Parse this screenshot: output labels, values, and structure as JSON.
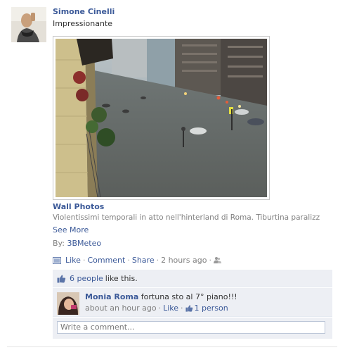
{
  "post": {
    "author": "Simone Cinelli",
    "status": "Impressionante",
    "attachment": {
      "title": "Wall Photos",
      "description": "Violentissimi temporali in atto nell'hinterland di Roma. Tiburtina paralizzata d...",
      "see_more": "See More",
      "by_prefix": "By:",
      "by_name": "3BMeteo"
    },
    "actions": {
      "like": "Like",
      "comment": "Comment",
      "share": "Share",
      "time": "2 hours ago",
      "separator": "·"
    }
  },
  "ufi": {
    "likes_link": "6 people",
    "likes_text": "like this.",
    "comment": {
      "author": "Monia Roma",
      "text": "fortuna sto al 7° piano!!!",
      "time": "about an hour ago",
      "like": "Like",
      "likes_count": "1 person"
    },
    "write_placeholder": "Write a comment..."
  },
  "icons": {
    "like": "thumbs-up-icon",
    "privacy": "friends-icon",
    "post_type": "photo-icon"
  },
  "colors": {
    "link": "#3b5998",
    "meta": "#808080",
    "ufi_bg": "#edeff4"
  }
}
